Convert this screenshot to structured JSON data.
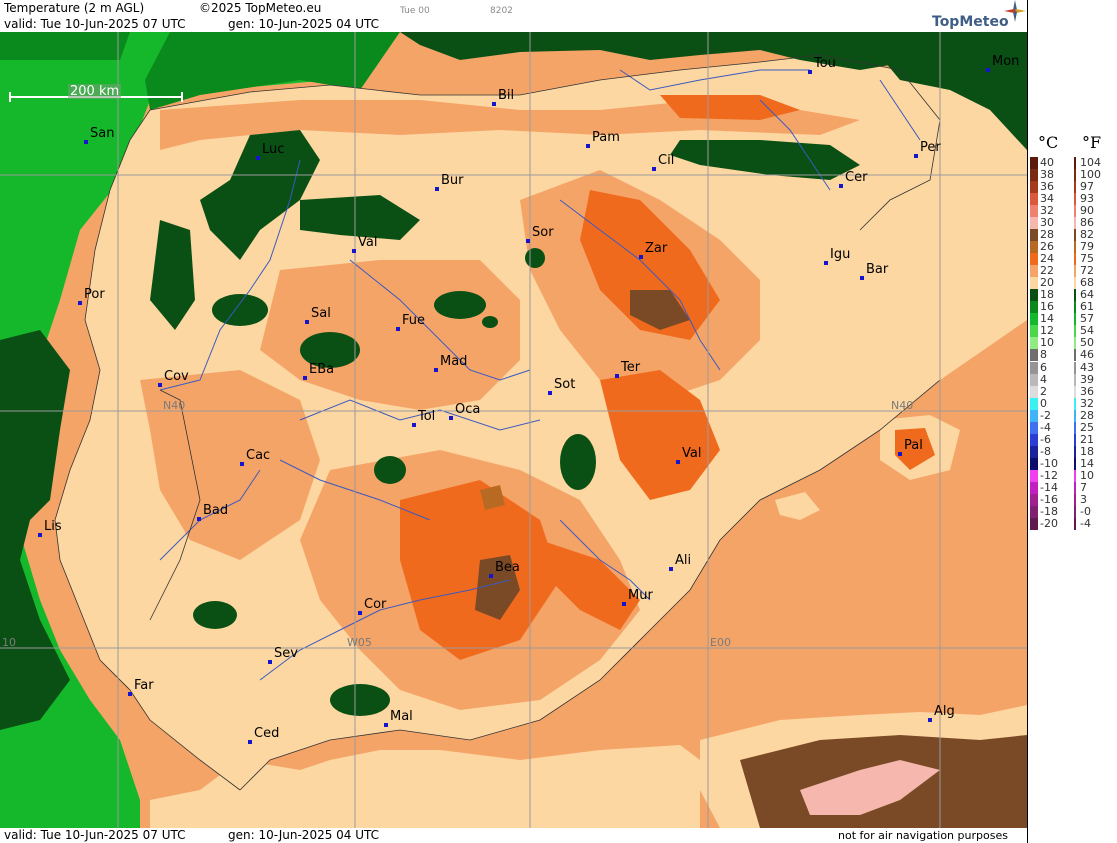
{
  "header": {
    "product": "Temperature (2 m AGL)",
    "copyright": "©2025 TopMeteo.eu",
    "valid_line": "valid:  Tue  10-Jun-2025  07 UTC",
    "gen_line": "gen: 10-Jun-2025 04 UTC",
    "run_label": "Tue 00",
    "code_label": "8202",
    "brand": "TopMeteo"
  },
  "footer": {
    "valid_line": "valid:  Tue  10-Jun-2025  07 UTC",
    "gen_line": "gen: 10-Jun-2025 04 UTC",
    "disclaimer": "not for air navigation purposes"
  },
  "scale_bar": {
    "label": "200 km"
  },
  "grid_labels": [
    {
      "id": "n40-west",
      "text": "N40"
    },
    {
      "id": "n40-east",
      "text": "N40"
    },
    {
      "id": "w10",
      "text": "10"
    },
    {
      "id": "w05",
      "text": "W05"
    },
    {
      "id": "e00",
      "text": "E00"
    }
  ],
  "cities": [
    {
      "id": "tou",
      "label": "Tou"
    },
    {
      "id": "mon",
      "label": "Mon"
    },
    {
      "id": "bil",
      "label": "Bil"
    },
    {
      "id": "san",
      "label": "San"
    },
    {
      "id": "pam",
      "label": "Pam"
    },
    {
      "id": "luc",
      "label": "Luc"
    },
    {
      "id": "cil",
      "label": "Cil"
    },
    {
      "id": "per",
      "label": "Per"
    },
    {
      "id": "bur",
      "label": "Bur"
    },
    {
      "id": "cer",
      "label": "Cer"
    },
    {
      "id": "sor",
      "label": "Sor"
    },
    {
      "id": "val-n",
      "label": "Val"
    },
    {
      "id": "zar",
      "label": "Zar"
    },
    {
      "id": "igu",
      "label": "Igu"
    },
    {
      "id": "bar",
      "label": "Bar"
    },
    {
      "id": "por",
      "label": "Por"
    },
    {
      "id": "sal",
      "label": "Sal"
    },
    {
      "id": "fue",
      "label": "Fue"
    },
    {
      "id": "mad",
      "label": "Mad"
    },
    {
      "id": "ter",
      "label": "Ter"
    },
    {
      "id": "cov",
      "label": "Cov"
    },
    {
      "id": "eba",
      "label": "EBa"
    },
    {
      "id": "sot",
      "label": "Sot"
    },
    {
      "id": "tol",
      "label": "Tol"
    },
    {
      "id": "oca",
      "label": "Oca"
    },
    {
      "id": "cac",
      "label": "Cac"
    },
    {
      "id": "val-e",
      "label": "Val"
    },
    {
      "id": "pal",
      "label": "Pal"
    },
    {
      "id": "bad",
      "label": "Bad"
    },
    {
      "id": "lis",
      "label": "Lis"
    },
    {
      "id": "bea",
      "label": "Bea"
    },
    {
      "id": "ali",
      "label": "Ali"
    },
    {
      "id": "mur",
      "label": "Mur"
    },
    {
      "id": "cor",
      "label": "Cor"
    },
    {
      "id": "sev",
      "label": "Sev"
    },
    {
      "id": "far",
      "label": "Far"
    },
    {
      "id": "alg",
      "label": "Alg"
    },
    {
      "id": "mal",
      "label": "Mal"
    },
    {
      "id": "ced",
      "label": "Ced"
    }
  ],
  "legend": {
    "unit_c": "°C",
    "unit_f": "°F",
    "celsius": [
      {
        "label": "40",
        "color": "#5c1a0c"
      },
      {
        "label": "38",
        "color": "#7a2a12"
      },
      {
        "label": "36",
        "color": "#a83a1c"
      },
      {
        "label": "34",
        "color": "#d85a3a"
      },
      {
        "label": "32",
        "color": "#f08070"
      },
      {
        "label": "30",
        "color": "#f6b8ae"
      },
      {
        "label": "28",
        "color": "#7a4a26"
      },
      {
        "label": "26",
        "color": "#b86a22"
      },
      {
        "label": "24",
        "color": "#f06a1e"
      },
      {
        "label": "22",
        "color": "#f5a468"
      },
      {
        "label": "20",
        "color": "#fdd7a2"
      },
      {
        "label": "18",
        "color": "#0a5014"
      },
      {
        "label": "16",
        "color": "#0a8a1c"
      },
      {
        "label": "14",
        "color": "#14b82a"
      },
      {
        "label": "12",
        "color": "#4ad84a"
      },
      {
        "label": "10",
        "color": "#92ea84"
      },
      {
        "label": "8",
        "color": "#6e6e6e"
      },
      {
        "label": "6",
        "color": "#959595"
      },
      {
        "label": "4",
        "color": "#b9b9b9"
      },
      {
        "label": "2",
        "color": "#dcdcdc"
      },
      {
        "label": "0",
        "color": "#3af0f0"
      },
      {
        "label": "-2",
        "color": "#40b4f8"
      },
      {
        "label": "-4",
        "color": "#4070f0"
      },
      {
        "label": "-6",
        "color": "#2a3ed4"
      },
      {
        "label": "-8",
        "color": "#1c229c"
      },
      {
        "label": "-10",
        "color": "#0c0c6a"
      },
      {
        "label": "-12",
        "color": "#f040f0"
      },
      {
        "label": "-14",
        "color": "#c020c0"
      },
      {
        "label": "-16",
        "color": "#a02090"
      },
      {
        "label": "-18",
        "color": "#802070"
      },
      {
        "label": "-20",
        "color": "#601a50"
      }
    ],
    "fahrenheit": [
      "104",
      "100",
      "97",
      "93",
      "90",
      "86",
      "82",
      "79",
      "75",
      "72",
      "68",
      "64",
      "61",
      "57",
      "54",
      "50",
      "46",
      "43",
      "39",
      "36",
      "32",
      "28",
      "25",
      "21",
      "18",
      "14",
      "10",
      "7",
      "3",
      "-0",
      "-4"
    ]
  },
  "colors": {
    "sea": "#f5a468",
    "land_base": "#fdd7a2",
    "warm": "#f5a468",
    "hot": "#f06a1e",
    "hotter": "#b86a22",
    "hottest": "#7a4a26",
    "cool": "#0a5014",
    "cooler": "#0a8a1c",
    "coast_sea": "#14b82a",
    "pink": "#f6b8ae",
    "red": "#d85a3a",
    "grid": "#9a9a9a",
    "rivers": "#3a5ac0",
    "city_dot": "#1515cc"
  }
}
